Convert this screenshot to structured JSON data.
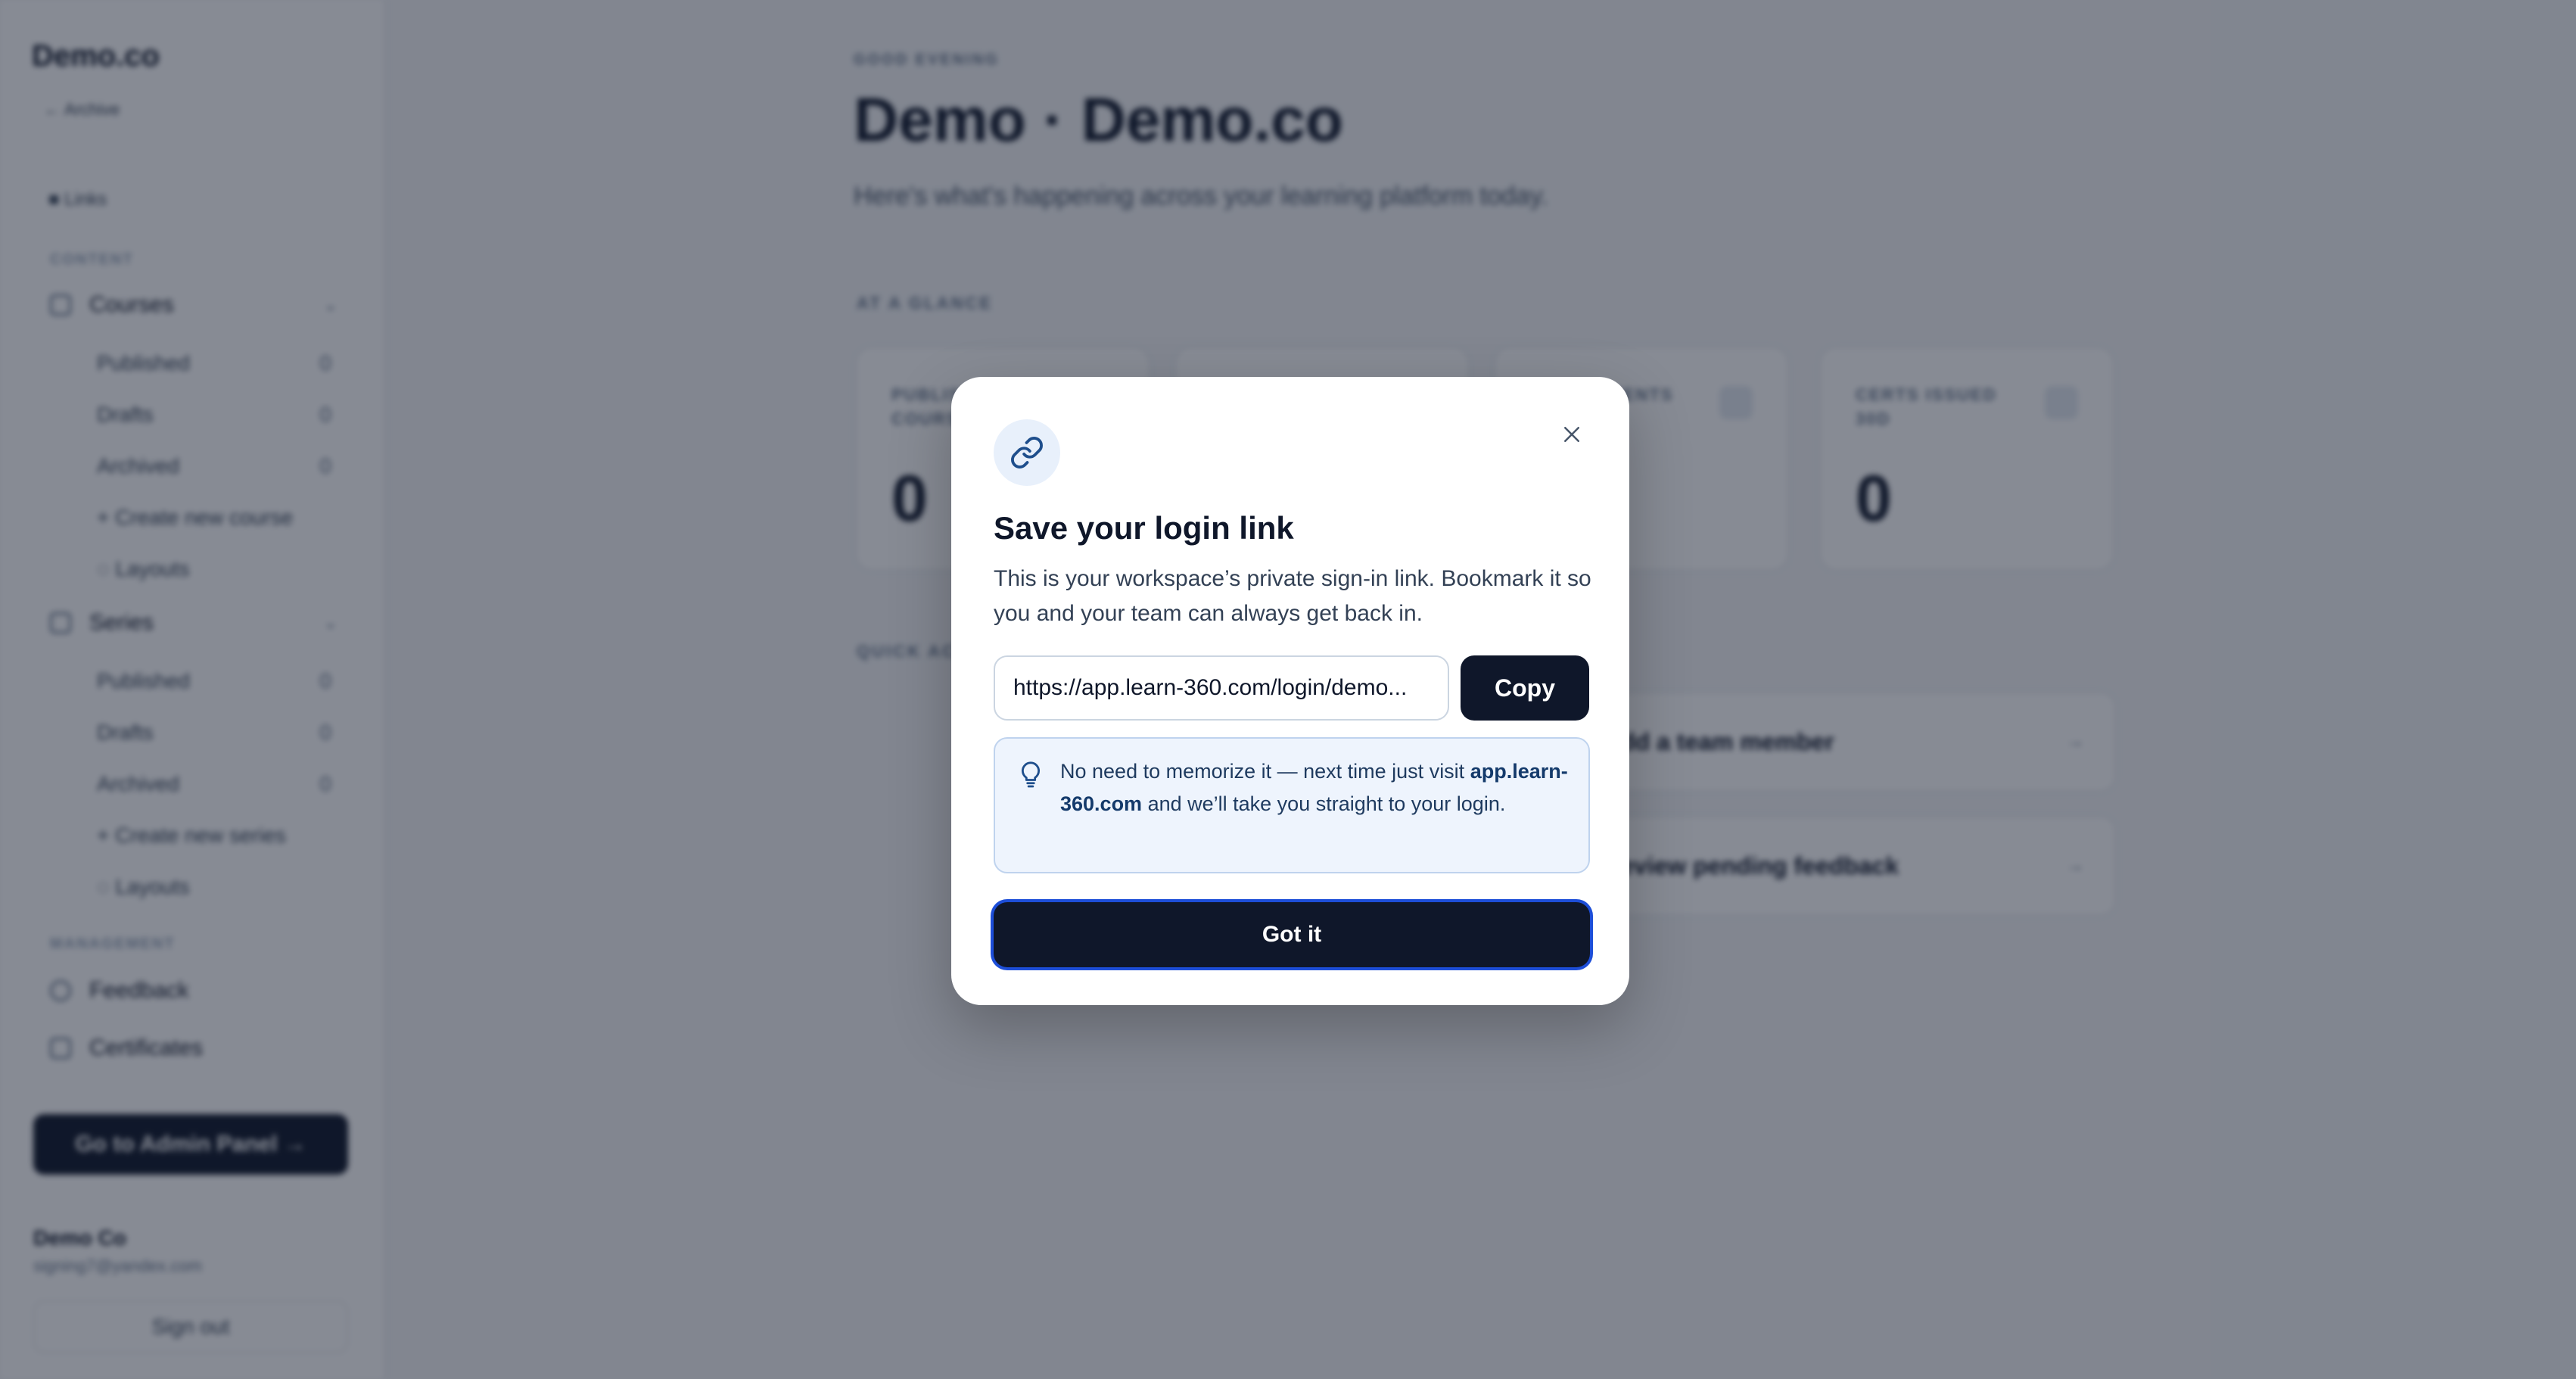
{
  "sidebar": {
    "brand": "Demo.co",
    "back_label": "← Archive",
    "links_label": "■ Links",
    "content_section": "CONTENT",
    "management_section": "MANAGEMENT",
    "courses": {
      "label": "Courses",
      "items": [
        {
          "label": "Published",
          "count": "0"
        },
        {
          "label": "Drafts",
          "count": "0"
        },
        {
          "label": "Archived",
          "count": "0"
        }
      ],
      "create": "+ Create new course",
      "layouts": "◌ Layouts"
    },
    "series": {
      "label": "Series",
      "items": [
        {
          "label": "Published",
          "count": "0"
        },
        {
          "label": "Drafts",
          "count": "0"
        },
        {
          "label": "Archived",
          "count": "0"
        }
      ],
      "create": "+ Create new series",
      "layouts": "◌ Layouts"
    },
    "feedback": "Feedback",
    "certificates": "Certificates",
    "admin_button": "Go to Admin Panel →",
    "org_name": "Demo Co",
    "email": "signing7@yandex.com",
    "signout": "Sign out"
  },
  "main": {
    "eyebrow": "GOOD EVENING",
    "title": "Demo · Demo.co",
    "subtitle": "Here's what's happening across your learning platform today.",
    "glance_label": "AT A GLANCE",
    "stats": [
      {
        "label": "PUBLISHED COURSES",
        "value": "0"
      },
      {
        "label": "",
        "value": ""
      },
      {
        "label": "ENROLLMENTS",
        "value": ""
      },
      {
        "label": "CERTS ISSUED 30D",
        "value": "0"
      }
    ],
    "quick_label": "QUICK ACTIONS",
    "quick_actions": [
      {
        "label": "Add a team member"
      },
      {
        "label": "Review pending feedback"
      }
    ]
  },
  "modal": {
    "title": "Save your login link",
    "description": "This is your workspace’s private sign-in link. Bookmark it so you and your team can always get back in.",
    "link_value": "https://app.learn-360.com/login/demo...",
    "copy_label": "Copy",
    "tip_prefix": "No need to memorize it — next time just visit ",
    "tip_domain": "app.learn-360.com",
    "tip_suffix": " and we’ll take you straight to your login.",
    "confirm_label": "Got it",
    "icon": "link-icon",
    "accent": "#0f172a",
    "focus_ring": "#1d4ed8"
  }
}
